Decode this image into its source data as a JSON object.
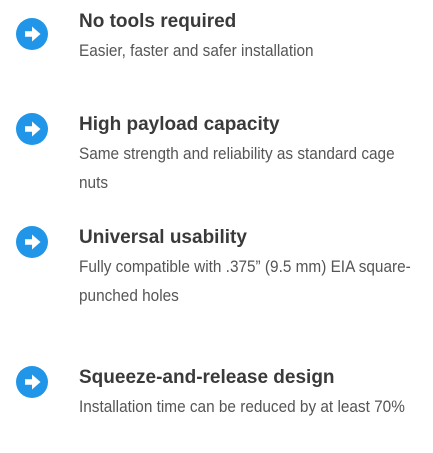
{
  "accent_color": "#2196e8",
  "features": [
    {
      "icon": "arrow-right-circle-icon",
      "title": "No tools required",
      "description": "Easier, faster and safer installation"
    },
    {
      "icon": "arrow-right-circle-icon",
      "title": "High payload capacity",
      "description": "Same strength and reliability as standard cage nuts"
    },
    {
      "icon": "arrow-right-circle-icon",
      "title": "Universal usability",
      "description": "Fully compatible with .375” (9.5 mm) EIA square-punched holes"
    },
    {
      "icon": "arrow-right-circle-icon",
      "title": "Squeeze-and-release design",
      "description": "Installation time can be reduced by at least 70%"
    }
  ]
}
